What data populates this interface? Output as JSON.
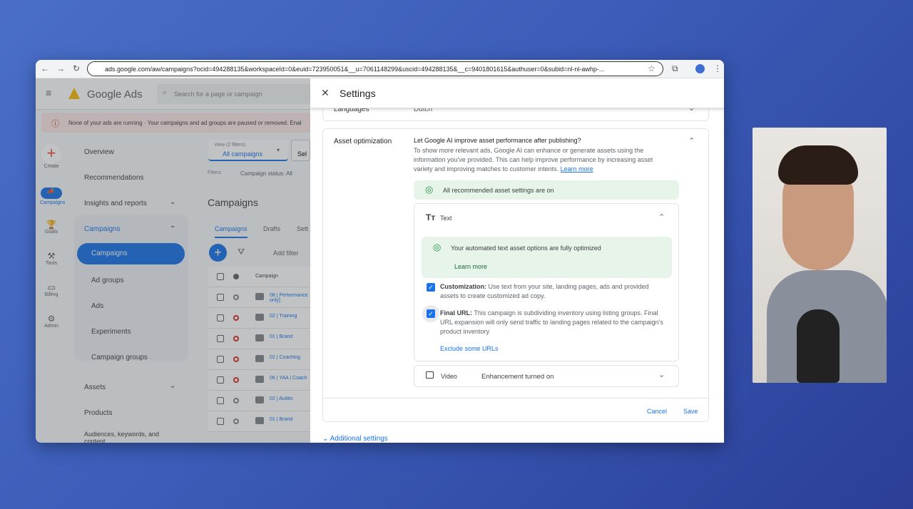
{
  "browser": {
    "url": "ads.google.com/aw/campaigns?ocid=494288135&workspaceId=0&euid=723950051&__u=7061148299&uscid=494288135&__c=9401801615&authuser=0&subid=nl-nl-awhp-..."
  },
  "app": {
    "title": "Google Ads",
    "search_placeholder": "Search for a page or campaign",
    "alert": "None of your ads are running · Your campaigns and ad groups are paused or removed. Enal"
  },
  "rail": [
    {
      "label": "Create"
    },
    {
      "label": "Campaigns"
    },
    {
      "label": "Goals"
    },
    {
      "label": "Tools"
    },
    {
      "label": "Billing"
    },
    {
      "label": "Admin"
    }
  ],
  "nav": {
    "overview": "Overview",
    "recommendations": "Recommendations",
    "insights": "Insights and reports",
    "campaigns_group": "Campaigns",
    "campaigns": "Campaigns",
    "ad_groups": "Ad groups",
    "ads": "Ads",
    "experiments": "Experiments",
    "campaign_groups": "Campaign groups",
    "assets": "Assets",
    "products": "Products",
    "audiences": "Audiences, keywords, and content"
  },
  "main": {
    "view_label": "View (2 filters)",
    "view_value": "All campaigns",
    "sel": "Sel",
    "filters_label": "Filters",
    "filter_value": "Campaign status: All",
    "title": "Campaigns",
    "tabs": [
      "Campaigns",
      "Drafts",
      "Sett"
    ],
    "add_filter": "Add filter",
    "col_campaign": "Campaign",
    "rows": [
      {
        "name": "08 | Performance only]",
        "status": "grey"
      },
      {
        "name": "02 | Training",
        "status": "red"
      },
      {
        "name": "01 | Brand",
        "status": "red"
      },
      {
        "name": "02 | Coaching",
        "status": "red"
      },
      {
        "name": "06 | YAA | Coach",
        "status": "red"
      },
      {
        "name": "02 | Audits",
        "status": "grey"
      },
      {
        "name": "01 | Brand",
        "status": "grey"
      }
    ]
  },
  "settings": {
    "title": "Settings",
    "languages_label": "Languages",
    "languages_value": "Dutch",
    "asset_label": "Asset optimization",
    "asset_question": "Let Google AI improve asset performance after publishing?",
    "asset_desc": "To show more relevant ads, Google AI can enhance or generate assets using the information you've provided. This can help improve performance by increasing asset variety and improving matches to customer intents.",
    "learn_more": "Learn more",
    "all_on": "All recommended asset settings are on",
    "text_label": "Text",
    "text_optimized": "Your automated text asset options are fully optimized",
    "text_learn_more": "Learn more",
    "custom_title": "Customization:",
    "custom_desc": " Use text from your site, landing pages, ads and provided assets to create customized ad copy.",
    "final_title": "Final URL:",
    "final_desc": " This campaign is subdividing inventory using listing groups. Final URL expansion will only send traffic to landing pages related to the campaign's product inventory",
    "exclude": "Exclude some URLs",
    "video_label": "Video",
    "video_value": "Enhancement turned on",
    "cancel": "Cancel",
    "save": "Save",
    "additional": "Additional settings"
  },
  "colors": {
    "accent": "#1a73e8",
    "success": "#1e8e3e",
    "success_bg": "#e6f4ea"
  }
}
